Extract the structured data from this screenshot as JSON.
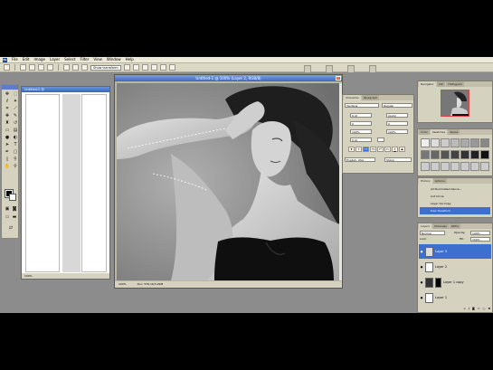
{
  "menu": {
    "logo": "Ps",
    "items": [
      "File",
      "Edit",
      "Image",
      "Layer",
      "Select",
      "Filter",
      "View",
      "Window",
      "Help"
    ]
  },
  "options_bar": {
    "brush_dynamics_label": "Show transform"
  },
  "docs": {
    "untitled2": {
      "title": "Untitled-2 @",
      "zoom": "100%"
    },
    "untitled1": {
      "title": "Untitled-1 @ 100% (Layer 2, RGB/8)",
      "zoom": "100%",
      "status": "Doc: 576.1K/3.29M"
    }
  },
  "navigator": {
    "tabs": [
      "Navigator",
      "Info",
      "Histogram"
    ]
  },
  "character": {
    "tabs": [
      "Character",
      "Paragraph"
    ],
    "font_family": "Verdana",
    "font_style": "Regular",
    "size": "6 pt",
    "leading": "(Auto)",
    "kerning": "0",
    "tracking": "0",
    "vscale": "100%",
    "hscale": "100%",
    "baseline": "0 pt",
    "language": "English: USA",
    "aa": "Sharp"
  },
  "swatches": {
    "tabs": [
      "Color",
      "Swatches",
      "Styles"
    ]
  },
  "history": {
    "tabs": [
      "History",
      "Actions"
    ],
    "items": [
      "All Illuminated dance...",
      "Cut Circle",
      "Layer Via Copy",
      "Free Transform"
    ]
  },
  "layers": {
    "tabs": [
      "Layers",
      "Channels",
      "Paths"
    ],
    "blend_mode": "Normal",
    "opacity_label": "Opacity:",
    "opacity": "100%",
    "lock_label": "Lock:",
    "fill_label": "Fill:",
    "fill": "100%",
    "rows": [
      {
        "name": "Layer 3",
        "selected": true
      },
      {
        "name": "Layer 2",
        "selected": false
      },
      {
        "name": "Layer 1 copy",
        "selected": false
      },
      {
        "name": "Layer 1",
        "selected": false
      }
    ]
  },
  "colors": {
    "menubar": "#ece9d8",
    "workspace": "#8c8c8c",
    "titlebar": "#3d69bd",
    "selection": "#3d6fcf"
  }
}
